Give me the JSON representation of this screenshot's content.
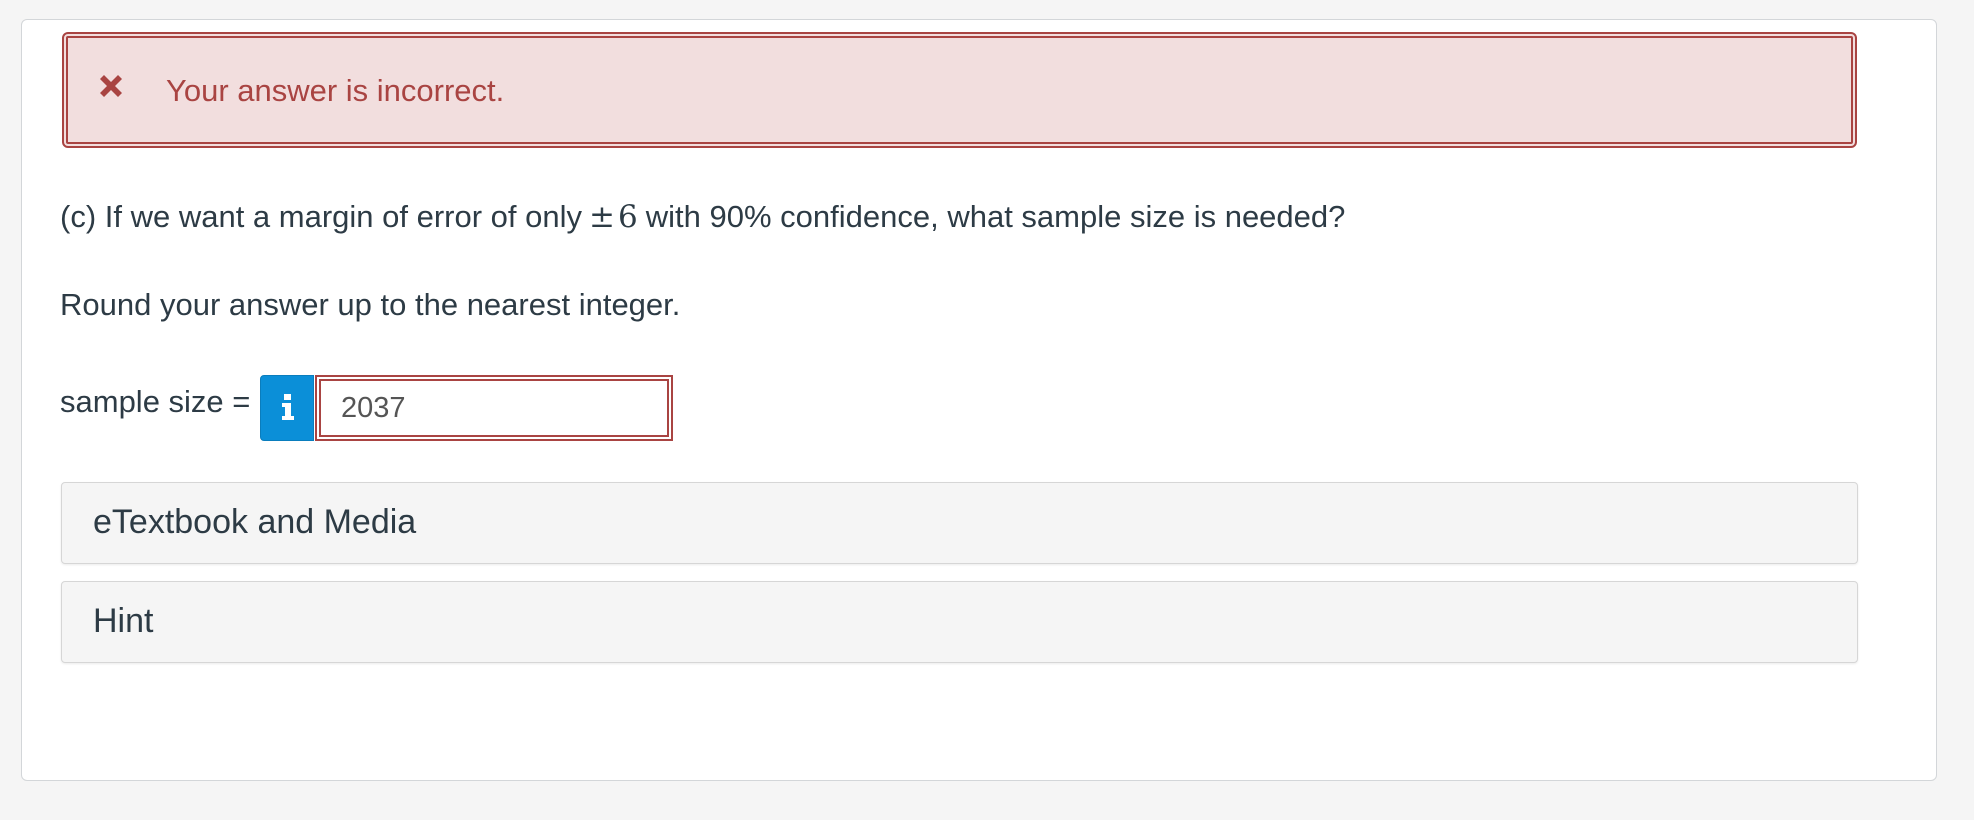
{
  "alert": {
    "icon": "close-icon",
    "color": "#a94442",
    "background": "#f2dede",
    "message": "Your answer is incorrect."
  },
  "question": {
    "prefix": "(c) If we want a margin of error of only",
    "plus_minus": "±",
    "value": "6",
    "suffix": "with 90% confidence, what sample size is needed?"
  },
  "instruction": "Round your answer up to the nearest integer.",
  "answer": {
    "label": "sample size =",
    "info_icon": "info-icon",
    "value": "2037",
    "info_button_color": "#0b8fd8"
  },
  "sections": {
    "etextbook": "eTextbook and Media",
    "hint": "Hint"
  }
}
